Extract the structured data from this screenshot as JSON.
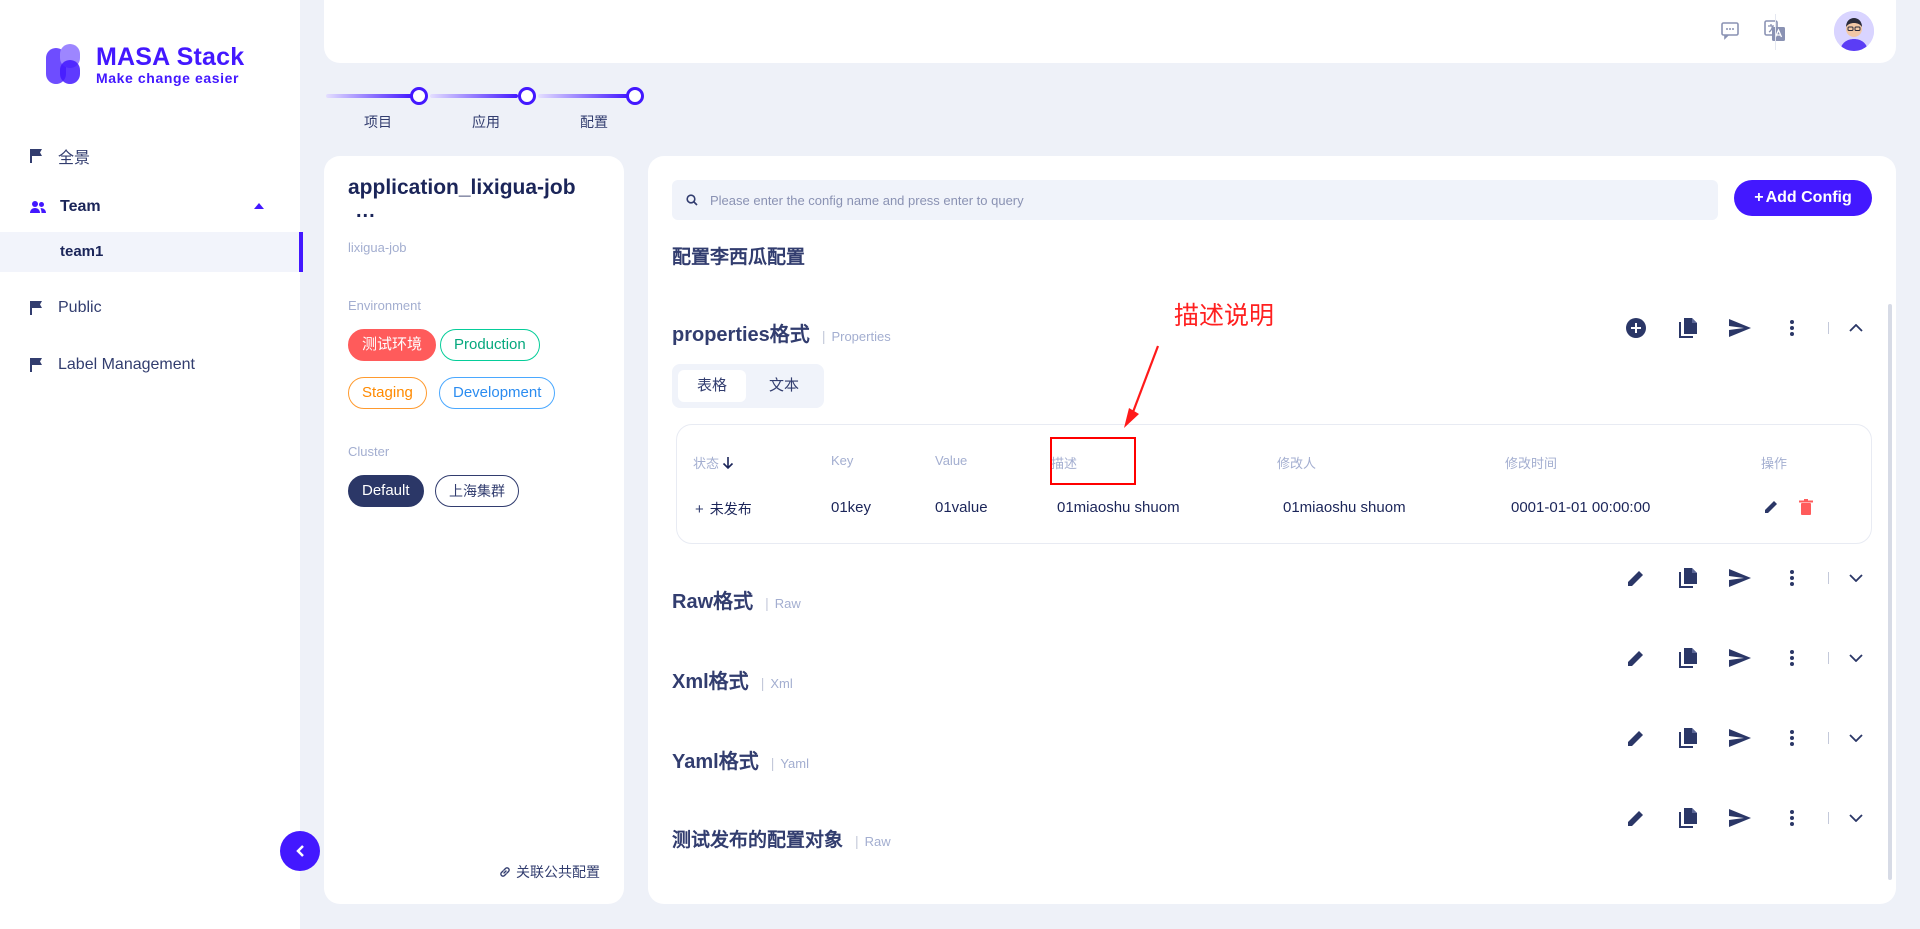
{
  "brand": {
    "name": "MASA Stack",
    "tagline": "Make change easier"
  },
  "sidebar": {
    "items": [
      {
        "label": "全景",
        "icon": "flag-icon"
      },
      {
        "label": "Team",
        "icon": "people-icon"
      },
      {
        "label": "team1"
      },
      {
        "label": "Public",
        "icon": "flag-icon"
      },
      {
        "label": "Label Management",
        "icon": "flag-icon"
      }
    ]
  },
  "stepper": {
    "steps": [
      "项目",
      "应用",
      "配置"
    ]
  },
  "app": {
    "title": "application_lixigua-job",
    "more": "...",
    "subtitle": "lixigua-job",
    "environment_label": "Environment",
    "environments": [
      "测试环境",
      "Production",
      "Staging",
      "Development"
    ],
    "cluster_label": "Cluster",
    "clusters": [
      "Default",
      "上海集群"
    ],
    "link_public": "关联公共配置"
  },
  "main": {
    "search_placeholder": "Please enter the config name and press enter to query",
    "add_button": "Add Config",
    "add_plus": "+",
    "partial_title": "配置李西瓜配置",
    "configs": [
      {
        "name": "properties格式",
        "type": "Properties",
        "expanded": true
      },
      {
        "name": "Raw格式",
        "type": "Raw"
      },
      {
        "name": "Xml格式",
        "type": "Xml"
      },
      {
        "name": "Yaml格式",
        "type": "Yaml"
      },
      {
        "name": "测试发布的配置对象",
        "type": "Raw"
      }
    ],
    "view_tabs": [
      "表格",
      "文本"
    ],
    "table": {
      "headers": [
        "状态",
        "Key",
        "Value",
        "描述",
        "修改人",
        "修改时间",
        "操作"
      ],
      "rows": [
        {
          "status": "未发布",
          "key": "01key",
          "value": "01value",
          "desc": "01miaoshu shuom",
          "modifier": "01miaoshu shuom",
          "time": "0001-01-01 00:00:00"
        }
      ]
    }
  },
  "annotation": {
    "text": "描述说明"
  },
  "colors": {
    "accent": "#4318ff",
    "text": "#323d6f",
    "danger": "#ff5b5b"
  }
}
